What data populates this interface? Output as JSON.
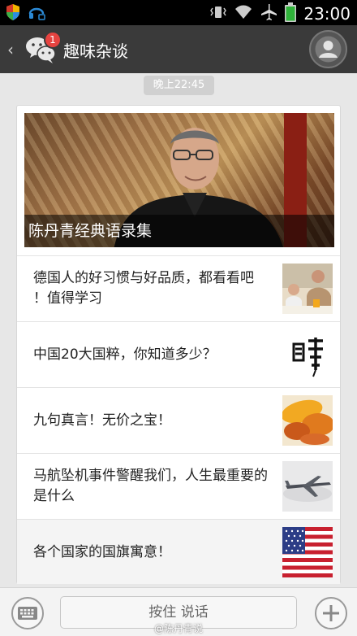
{
  "status_bar": {
    "time": "23:00",
    "icons": [
      "shield-icon",
      "headset-icon",
      "vibrate-icon",
      "wifi-icon",
      "airplane-icon",
      "battery-icon"
    ]
  },
  "header": {
    "back_symbol": "‹",
    "unread_count": "1",
    "title": "趣味杂谈"
  },
  "time_pill": "晚上22:45",
  "article_card": {
    "hero_title": "陈丹青经典语录集",
    "items": [
      {
        "title": "德国人的好习惯与好品质，都看看吧 ！值得学习",
        "thumb_icon": "family-breakfast-photo"
      },
      {
        "title": "中国20大国粹，你知道多少？",
        "thumb_icon": "calligraphy-image"
      },
      {
        "title": "九句真言！无价之宝！",
        "thumb_icon": "autumn-leaves-photo"
      },
      {
        "title": "马航坠机事件警醒我们，人生最重要的是什么",
        "thumb_icon": "airplane-photo"
      },
      {
        "title": "各个国家的国旗寓意！",
        "thumb_icon": "us-flag-image"
      }
    ]
  },
  "bottom_bar": {
    "hold_to_talk": "按住 说话",
    "watermark": "@陈丹青说"
  },
  "colors": {
    "header_bg": "#3a3a3a",
    "badge": "#e64340",
    "page_bg": "#e7e7e7"
  }
}
